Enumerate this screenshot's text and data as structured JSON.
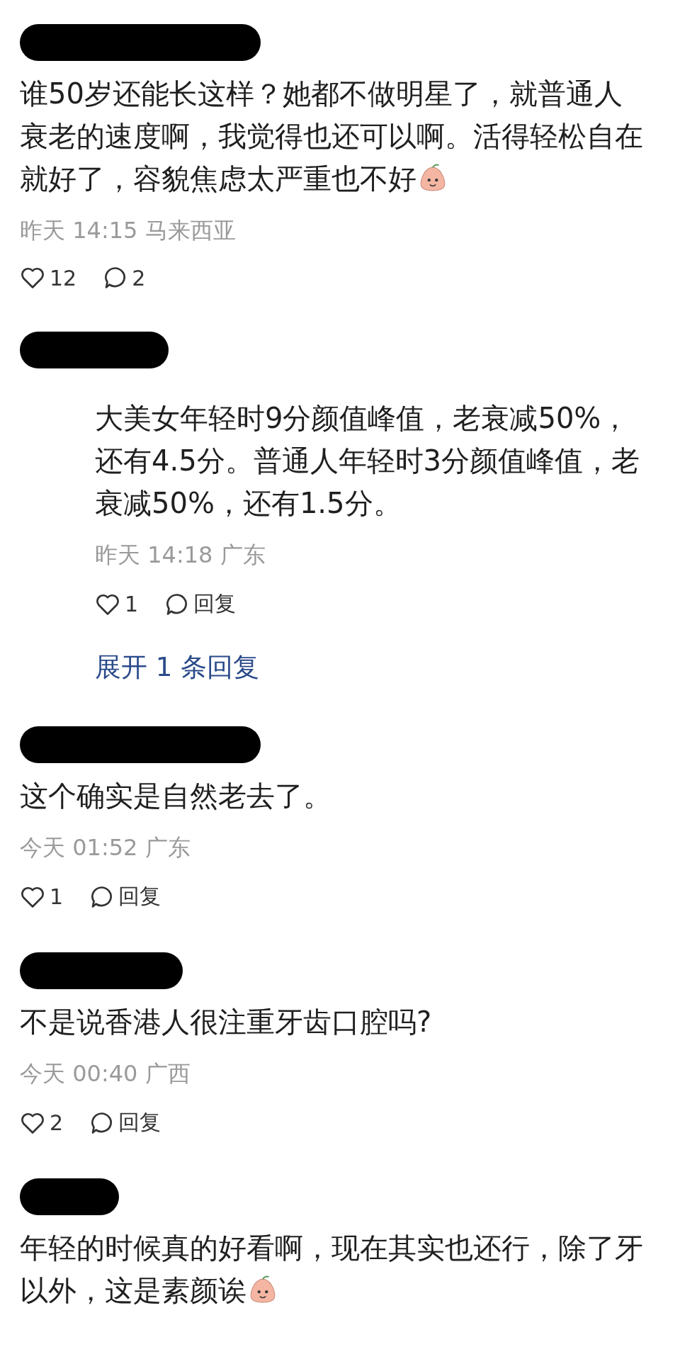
{
  "comments": [
    {
      "indented": false,
      "text": "谁50岁还能长这样？她都不做明星了，就普通人衰老的速度啊，我觉得也还可以啊。活得轻松自在就好了，容貌焦虑太严重也不好",
      "emoji": true,
      "meta": "昨天 14:15 马来西亚",
      "likes": "12",
      "reply": "2"
    },
    {
      "indented": true,
      "text": "大美女年轻时9分颜值峰值，老衰减50%，还有4.5分。普通人年轻时3分颜值峰值，老衰减50%，还有1.5分。",
      "meta": "昨天 14:18 广东",
      "likes": "1",
      "reply": "回复",
      "expand": "展开 1 条回复"
    },
    {
      "indented": false,
      "text": "这个确实是自然老去了。",
      "meta": "今天 01:52 广东",
      "likes": "1",
      "reply": "回复"
    },
    {
      "indented": false,
      "text": "不是说香港人很注重牙齿口腔吗?",
      "meta": "今天 00:40 广西",
      "likes": "2",
      "reply": "回复"
    },
    {
      "indented": false,
      "text": "年轻的时候真的好看啊，现在其实也还行，除了牙以外，这是素颜诶",
      "emoji": true
    }
  ]
}
